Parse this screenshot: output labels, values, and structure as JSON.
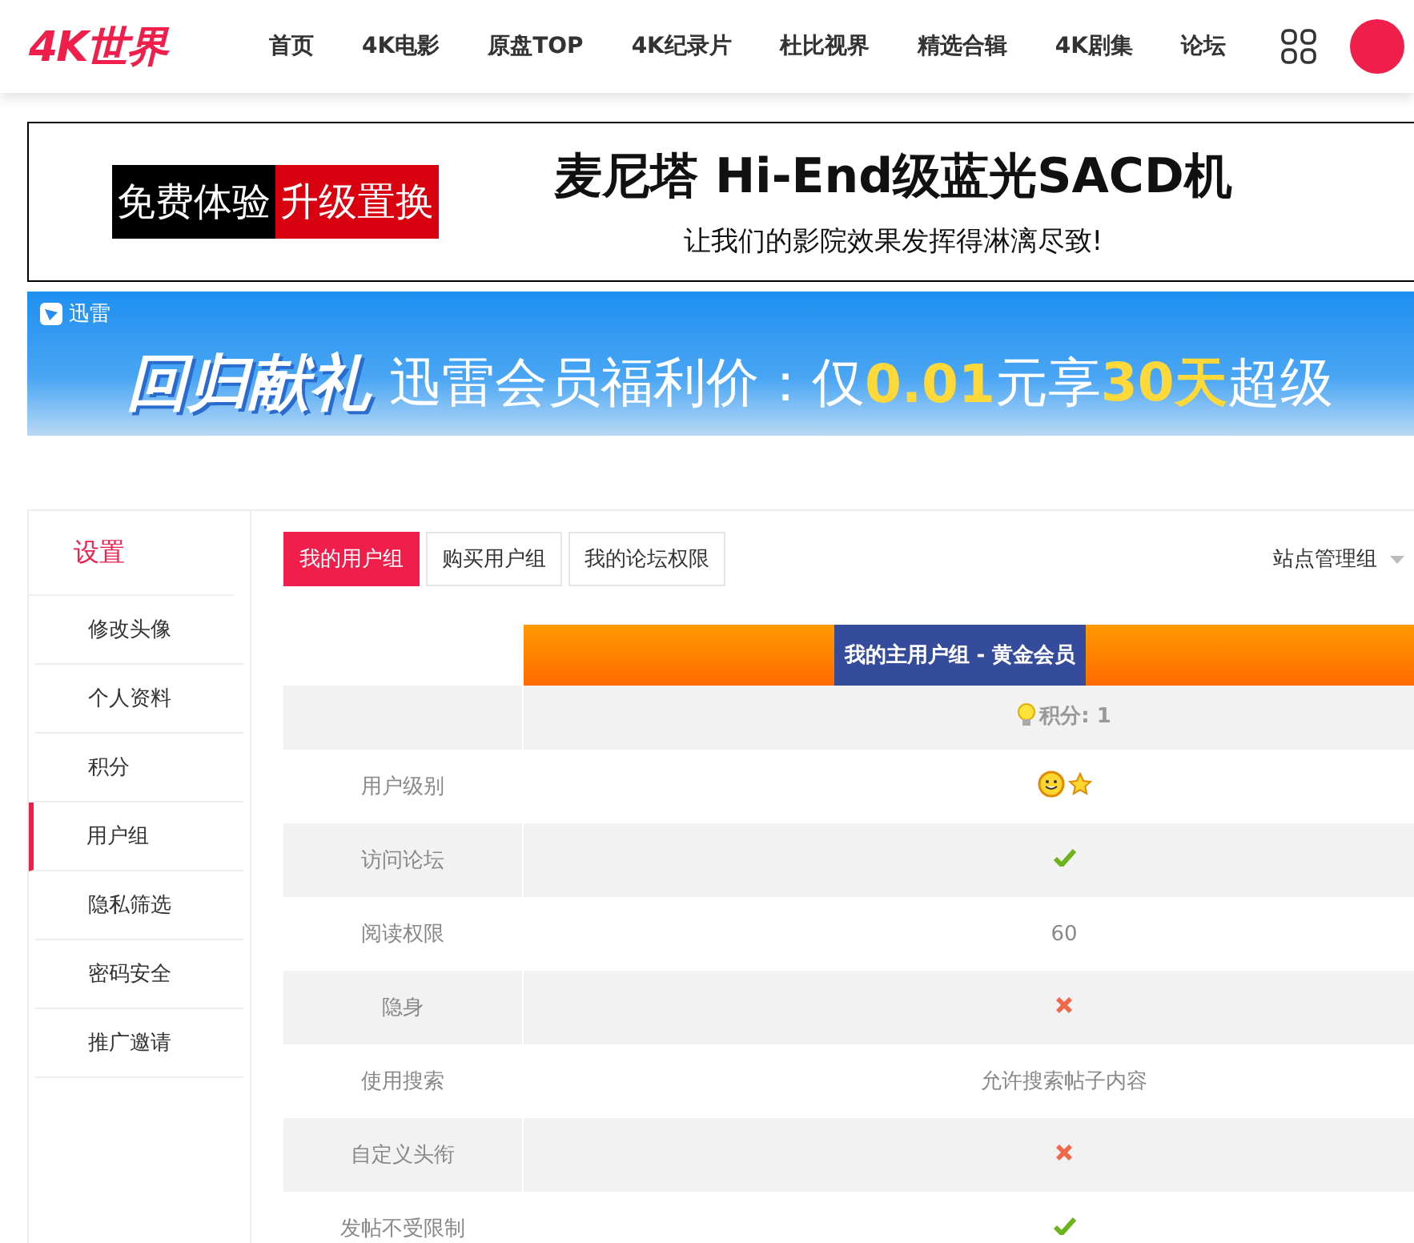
{
  "header": {
    "logo": "4K世界",
    "nav": [
      {
        "label": "首页"
      },
      {
        "label": "4K电影"
      },
      {
        "label": "原盘TOP"
      },
      {
        "label": "4K纪录片"
      },
      {
        "label": "杜比视界"
      },
      {
        "label": "精选合辑"
      },
      {
        "label": "4K剧集"
      },
      {
        "label": "论坛"
      }
    ]
  },
  "ad_banner": {
    "badge_left": "免费体验",
    "badge_right": "升级置换",
    "title": "麦尼塔 Hi-End级蓝光SACD机",
    "subtitle": "让我们的影院效果发挥得淋漓尽致!"
  },
  "promo_banner": {
    "brand": "迅雷",
    "slogan": "回归献礼",
    "segments": [
      {
        "text": "迅雷会员福利价：仅",
        "highlight": false
      },
      {
        "text": "0.01",
        "highlight": true
      },
      {
        "text": "元享",
        "highlight": false
      },
      {
        "text": "30天",
        "highlight": true
      },
      {
        "text": "超级",
        "highlight": false
      }
    ]
  },
  "sidebar": {
    "title": "设置",
    "items": [
      {
        "label": "修改头像",
        "selected": false
      },
      {
        "label": "个人资料",
        "selected": false
      },
      {
        "label": "积分",
        "selected": false
      },
      {
        "label": "用户组",
        "selected": true
      },
      {
        "label": "隐私筛选",
        "selected": false
      },
      {
        "label": "密码安全",
        "selected": false
      },
      {
        "label": "推广邀请",
        "selected": false
      }
    ]
  },
  "tabs": [
    {
      "label": "我的用户组",
      "selected": true
    },
    {
      "label": "购买用户组",
      "selected": false
    },
    {
      "label": "我的论坛权限",
      "selected": false
    }
  ],
  "group_select": {
    "value": "站点管理组"
  },
  "table": {
    "header": "我的主用户组 - 黄金会员",
    "points": "积分: 1",
    "rows": [
      {
        "label": "用户级别",
        "kind": "icons"
      },
      {
        "label": "访问论坛",
        "kind": "check"
      },
      {
        "label": "阅读权限",
        "kind": "text",
        "value": "60"
      },
      {
        "label": "隐身",
        "kind": "cross"
      },
      {
        "label": "使用搜索",
        "kind": "text",
        "value": "允许搜索帖子内容"
      },
      {
        "label": "自定义头衔",
        "kind": "cross"
      },
      {
        "label": "发帖不受限制",
        "kind": "check"
      }
    ]
  }
}
